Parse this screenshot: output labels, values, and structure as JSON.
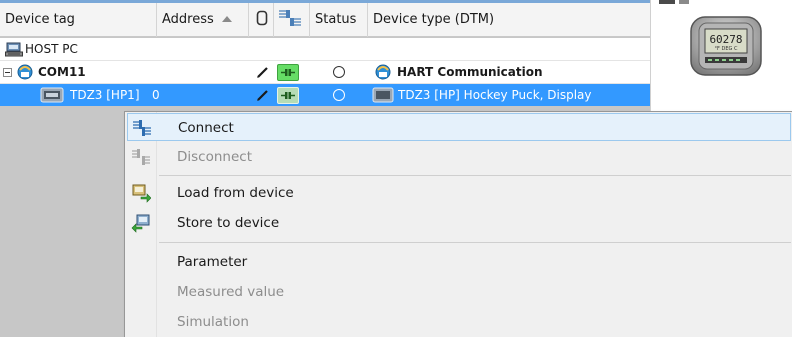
{
  "columns": {
    "device_tag": "Device tag",
    "address": "Address",
    "status": "Status",
    "device_type": "Device type (DTM)"
  },
  "rows": [
    {
      "tag": "HOST PC",
      "address": "",
      "device_type": ""
    },
    {
      "tag": "COM11",
      "address": "",
      "device_type": "HART Communication"
    },
    {
      "tag": "TDZ3 [HP1]",
      "address": "0",
      "device_type": "TDZ3 [HP] Hockey Puck, Display"
    }
  ],
  "preview": {
    "device_display": "60278",
    "device_unit": "°F DEG C"
  },
  "context_menu": [
    {
      "label": "Connect",
      "enabled": true,
      "hover": true,
      "icon": "connect-icon"
    },
    {
      "label": "Disconnect",
      "enabled": false,
      "icon": "disconnect-icon"
    },
    {
      "label": "Load from device",
      "enabled": true,
      "icon": "load-from-device-icon"
    },
    {
      "label": "Store to device",
      "enabled": true,
      "icon": "store-to-device-icon"
    },
    {
      "label": "Parameter",
      "enabled": true,
      "icon": ""
    },
    {
      "label": "Measured value",
      "enabled": false,
      "icon": ""
    },
    {
      "label": "Simulation",
      "enabled": false,
      "icon": ""
    }
  ],
  "colors": {
    "selection": "#3399ff",
    "menu_hover": "#e5f1fb",
    "connected_green": "#66dd66"
  }
}
